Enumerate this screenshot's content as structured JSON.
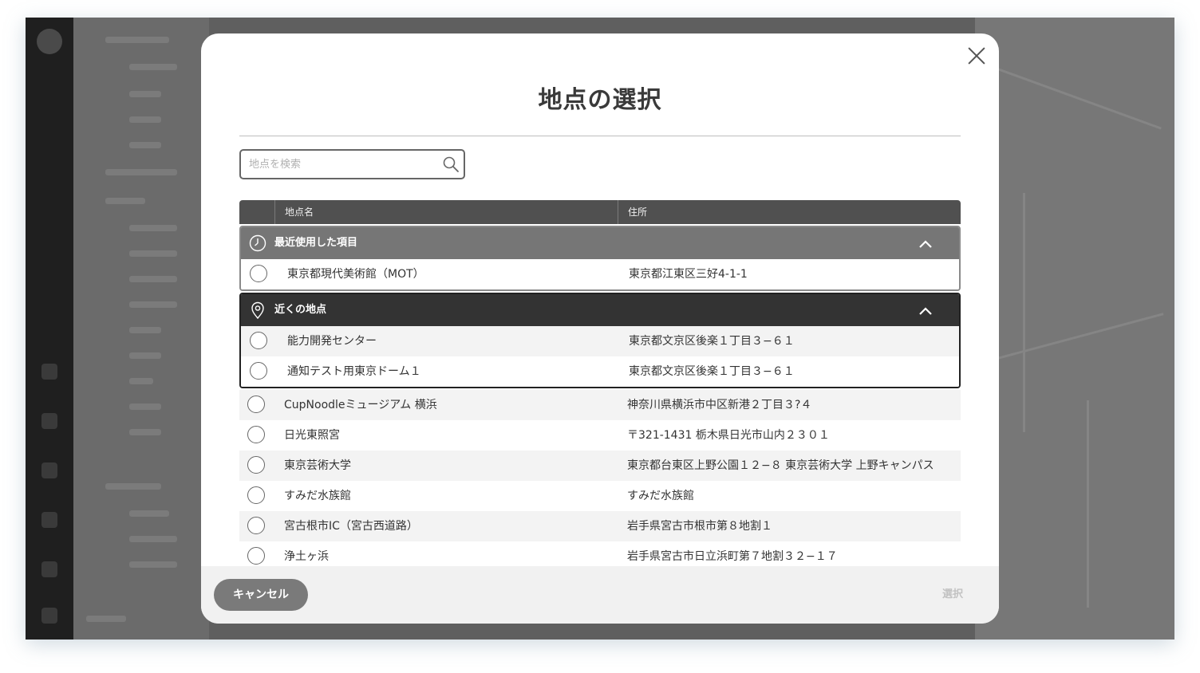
{
  "dialog": {
    "title": "地点の選択",
    "search_placeholder": "地点を検索",
    "columns": {
      "name": "地点名",
      "address": "住所"
    },
    "groups": [
      {
        "label": "最近使用した項目",
        "icon": "clock-icon",
        "expanded": true,
        "rows": [
          {
            "name": "東京都現代美術館（MOT）",
            "address": "東京都江東区三好4-1-1"
          }
        ]
      },
      {
        "label": "近くの地点",
        "icon": "map-pin-icon",
        "expanded": true,
        "rows": [
          {
            "name": "能力開発センター",
            "address": "東京都文京区後楽１丁目３−６１"
          },
          {
            "name": "通知テスト用東京ドーム１",
            "address": "東京都文京区後楽１丁目３−６１"
          }
        ]
      }
    ],
    "rows": [
      {
        "name": "CupNoodleミュージアム 横浜",
        "address": "神奈川県横浜市中区新港２丁目３?４"
      },
      {
        "name": "日光東照宮",
        "address": "〒321-1431 栃木県日光市山内２３０１"
      },
      {
        "name": "東京芸術大学",
        "address": "東京都台東区上野公園１２−８ 東京芸術大学 上野キャンパス"
      },
      {
        "name": "すみだ水族館",
        "address": "すみだ水族館"
      },
      {
        "name": "宮古根市IC（宮古西道路）",
        "address": "岩手県宮古市根市第８地割１"
      },
      {
        "name": "浄土ヶ浜",
        "address": "岩手県宮古市日立浜町第７地割３２−１７"
      }
    ],
    "cancel_label": "キャンセル",
    "select_label": "選択"
  },
  "colors": {
    "header_bg": "#505050",
    "recent_group_bg": "#767676",
    "nearby_group_bg": "#333333",
    "cancel_button": "#7a7a7a",
    "select_disabled": "#c2c2c2"
  }
}
